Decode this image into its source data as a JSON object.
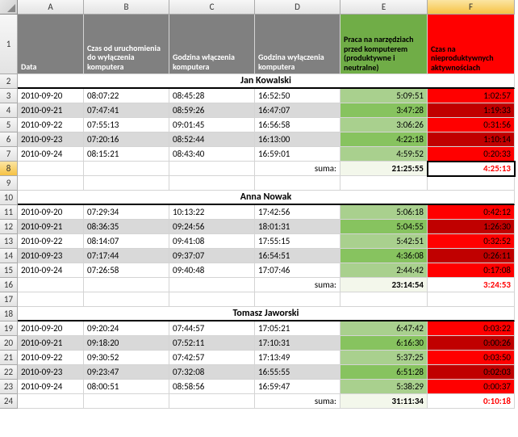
{
  "col_letters": [
    "A",
    "B",
    "C",
    "D",
    "E",
    "F"
  ],
  "row_numbers": [
    "1",
    "2",
    "3",
    "4",
    "5",
    "6",
    "7",
    "8",
    "9",
    "10",
    "11",
    "12",
    "13",
    "14",
    "15",
    "16",
    "17",
    "18",
    "19",
    "20",
    "21",
    "22",
    "23",
    "24"
  ],
  "headers": {
    "A": "Data",
    "B": "Czas od uruchomienia do wyłączenia komputera",
    "C": "Godzina włączenia komputera",
    "D": "Godzina wyłączenia komputera",
    "E": "Praca na narzędziach przed komputerem (produktywne i neutralne)",
    "F": "Czas na nieproduktywnych aktywnościach"
  },
  "sum_label": "suma:",
  "people": [
    {
      "name": "Jan Kowalski",
      "rows": [
        {
          "date": "2010-09-20",
          "dur": "08:07:22",
          "on": "08:45:28",
          "off": "16:52:50",
          "e": "5:09:51",
          "f": "1:02:57"
        },
        {
          "date": "2010-09-21",
          "dur": "07:47:41",
          "on": "08:59:26",
          "off": "16:47:07",
          "e": "3:47:28",
          "f": "1:19:33"
        },
        {
          "date": "2010-09-22",
          "dur": "07:55:13",
          "on": "09:01:45",
          "off": "16:56:58",
          "e": "3:06:26",
          "f": "0:31:56"
        },
        {
          "date": "2010-09-23",
          "dur": "07:20:16",
          "on": "08:52:44",
          "off": "16:13:00",
          "e": "4:22:18",
          "f": "1:10:14"
        },
        {
          "date": "2010-09-24",
          "dur": "08:15:21",
          "on": "08:43:40",
          "off": "16:59:01",
          "e": "4:59:52",
          "f": "0:20:33"
        }
      ],
      "sum_e": "21:25:55",
      "sum_f": "4:25:13"
    },
    {
      "name": "Anna Nowak",
      "rows": [
        {
          "date": "2010-09-20",
          "dur": "07:29:34",
          "on": "10:13:22",
          "off": "17:42:56",
          "e": "5:06:18",
          "f": "0:42:12"
        },
        {
          "date": "2010-09-21",
          "dur": "08:36:35",
          "on": "09:24:56",
          "off": "18:01:31",
          "e": "5:04:55",
          "f": "1:26:30"
        },
        {
          "date": "2010-09-22",
          "dur": "08:14:07",
          "on": "09:41:08",
          "off": "17:55:15",
          "e": "5:42:51",
          "f": "0:32:52"
        },
        {
          "date": "2010-09-23",
          "dur": "07:17:44",
          "on": "09:37:07",
          "off": "16:54:51",
          "e": "4:36:08",
          "f": "0:26:11"
        },
        {
          "date": "2010-09-24",
          "dur": "07:26:58",
          "on": "09:40:48",
          "off": "17:07:46",
          "e": "2:44:42",
          "f": "0:17:08"
        }
      ],
      "sum_e": "23:14:54",
      "sum_f": "3:24:53"
    },
    {
      "name": "Tomasz Jaworski",
      "rows": [
        {
          "date": "2010-09-20",
          "dur": "09:20:24",
          "on": "07:44:57",
          "off": "17:05:21",
          "e": "6:47:42",
          "f": "0:03:22"
        },
        {
          "date": "2010-09-21",
          "dur": "09:18:20",
          "on": "07:52:11",
          "off": "17:10:31",
          "e": "6:16:30",
          "f": "0:00:26"
        },
        {
          "date": "2010-09-22",
          "dur": "09:30:52",
          "on": "07:42:57",
          "off": "17:13:49",
          "e": "5:37:25",
          "f": "0:03:50"
        },
        {
          "date": "2010-09-23",
          "dur": "09:23:47",
          "on": "07:32:08",
          "off": "16:55:55",
          "e": "6:51:28",
          "f": "0:02:03"
        },
        {
          "date": "2010-09-24",
          "dur": "08:00:51",
          "on": "08:58:56",
          "off": "16:59:47",
          "e": "5:38:29",
          "f": "0:00:37"
        }
      ],
      "sum_e": "31:11:34",
      "sum_f": "0:10:18"
    }
  ]
}
